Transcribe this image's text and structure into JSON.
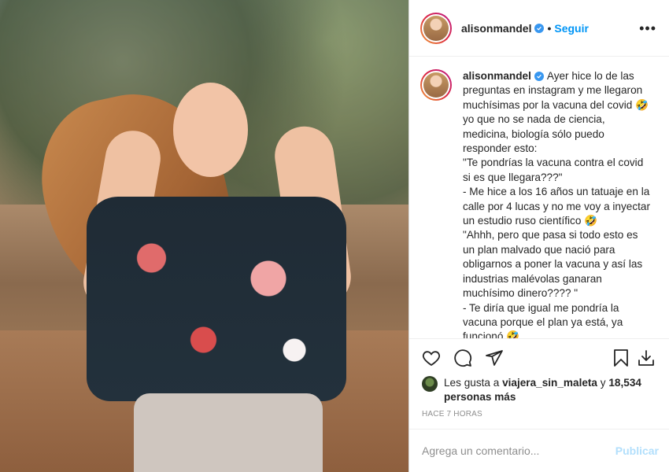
{
  "post": {
    "username": "alisonmandel",
    "follow_label": "Seguir",
    "separator": "•",
    "more_label": "•••",
    "caption": "Ayer hice lo de las preguntas en instagram y me llegaron muchísimas por la vacuna del covid 🤣 yo que no se nada de ciencia, medicina, biología sólo puedo responder esto:\n\"Te pondrías la vacuna contra el covid si es que llegara???\"\n- Me hice a los 16 años un tatuaje en la calle por 4 lucas y no me voy a inyectar un estudio ruso científico 🤣\n\"Ahhh, pero que pasa si todo esto es un plan malvado que nació para obligarnos a poner la vacuna y así las industrias malévolas ganaran muchísimo dinero???? \"\n- Te diría que igual me pondría la vacuna porque el plan ya está, ya funcionó 🤣",
    "likes": {
      "prefix": "Les gusta a",
      "first_liker": "viajera_sin_maleta",
      "conjunction": "y",
      "others": "18,534 personas más"
    },
    "time": "HACE 7 HORAS",
    "comment": {
      "placeholder": "Agrega un comentario...",
      "publish_label": "Publicar"
    }
  },
  "colors": {
    "accent": "#0095f6",
    "verified": "#3897f0",
    "publish_disabled": "#b2dffc",
    "muted": "#8e8e8e",
    "border": "#efefef"
  },
  "icons": {
    "verified": "verified-badge-icon",
    "like": "heart-icon",
    "comment": "speech-bubble-icon",
    "share": "paper-plane-icon",
    "save": "bookmark-icon",
    "download": "download-icon"
  }
}
